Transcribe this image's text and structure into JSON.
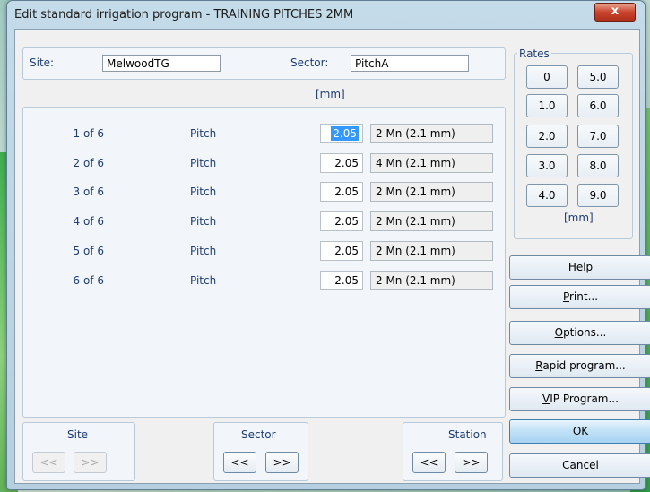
{
  "window": {
    "title": "Edit standard irrigation program - TRAINING PITCHES 2MM",
    "close_glyph": "x"
  },
  "site": {
    "label": "Site:",
    "value": "MelwoodTG"
  },
  "sector": {
    "label": "Sector:",
    "value": "PitchA"
  },
  "rate_unit": "[mm]",
  "stations": [
    {
      "station": "1 of 6",
      "type": "Pitch",
      "rate": "2.05",
      "program": "2 Mn (2.1 mm)"
    },
    {
      "station": "2 of 6",
      "type": "Pitch",
      "rate": "2.05",
      "program": "4 Mn (2.1 mm)"
    },
    {
      "station": "3 of 6",
      "type": "Pitch",
      "rate": "2.05",
      "program": "2 Mn (2.1 mm)"
    },
    {
      "station": "4 of 6",
      "type": "Pitch",
      "rate": "2.05",
      "program": "2 Mn (2.1 mm)"
    },
    {
      "station": "5 of 6",
      "type": "Pitch",
      "rate": "2.05",
      "program": "2 Mn (2.1 mm)"
    },
    {
      "station": "6 of 6",
      "type": "Pitch",
      "rate": "2.05",
      "program": "2 Mn (2.1 mm)"
    }
  ],
  "rates": {
    "title": "Rates",
    "buttons": [
      "0",
      "5.0",
      "1.0",
      "6.0",
      "2.0",
      "7.0",
      "3.0",
      "8.0",
      "4.0",
      "9.0"
    ],
    "unit": "[mm]"
  },
  "side_buttons": {
    "help": "Help",
    "print": {
      "mnemonic": "P",
      "rest": "rint..."
    },
    "options": {
      "mnemonic": "O",
      "rest": "ptions..."
    },
    "rapid": {
      "mnemonic": "R",
      "rest": "apid program..."
    },
    "vip": {
      "mnemonic": "V",
      "rest": "IP Program..."
    },
    "ok": "OK",
    "cancel": "Cancel"
  },
  "nav": {
    "site": {
      "title": "Site",
      "prev": "<<",
      "next": ">>",
      "enabled": false
    },
    "sector": {
      "title": "Sector",
      "prev": "<<",
      "next": ">>",
      "enabled": true
    },
    "station": {
      "title": "Station",
      "prev": "<<",
      "next": ">>",
      "enabled": true
    }
  }
}
